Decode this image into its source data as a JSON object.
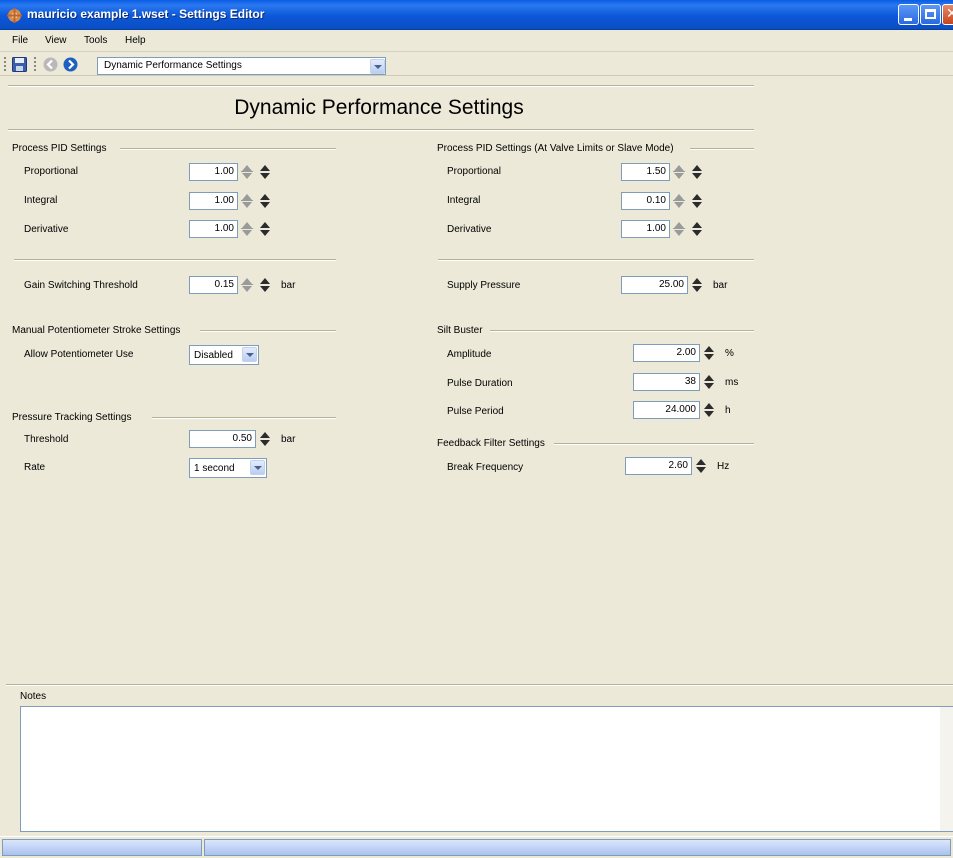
{
  "window": {
    "title": "mauricio example 1.wset - Settings Editor"
  },
  "menu": [
    "File",
    "View",
    "Tools",
    "Help"
  ],
  "toolbar": {
    "nav_combo_value": "Dynamic Performance Settings"
  },
  "page": {
    "heading": "Dynamic Performance Settings"
  },
  "left": {
    "process_pid": {
      "title": "Process PID Settings",
      "proportional_label": "Proportional",
      "proportional_value": "1.00",
      "integral_label": "Integral",
      "integral_value": "1.00",
      "derivative_label": "Derivative",
      "derivative_value": "1.00"
    },
    "gain_switching": {
      "label": "Gain Switching Threshold",
      "value": "0.15",
      "unit": "bar"
    },
    "manual_pot": {
      "title": "Manual Potentiometer Stroke Settings",
      "allow_label": "Allow Potentiometer Use",
      "allow_value": "Disabled"
    },
    "pressure_tracking": {
      "title": "Pressure Tracking Settings",
      "threshold_label": "Threshold",
      "threshold_value": "0.50",
      "threshold_unit": "bar",
      "rate_label": "Rate",
      "rate_value": "1 second"
    }
  },
  "right": {
    "process_pid_limits": {
      "title": "Process PID Settings (At Valve Limits or Slave Mode)",
      "proportional_label": "Proportional",
      "proportional_value": "1.50",
      "integral_label": "Integral",
      "integral_value": "0.10",
      "derivative_label": "Derivative",
      "derivative_value": "1.00"
    },
    "supply_pressure": {
      "label": "Supply Pressure",
      "value": "25.00",
      "unit": "bar"
    },
    "silt_buster": {
      "title": "Silt Buster",
      "amplitude_label": "Amplitude",
      "amplitude_value": "2.00",
      "amplitude_unit": "%",
      "pulse_duration_label": "Pulse Duration",
      "pulse_duration_value": "38",
      "pulse_duration_unit": "ms",
      "pulse_period_label": "Pulse Period",
      "pulse_period_value": "24.000",
      "pulse_period_unit": "h"
    },
    "feedback_filter": {
      "title": "Feedback Filter Settings",
      "break_frequency_label": "Break Frequency",
      "break_frequency_value": "2.60",
      "break_frequency_unit": "Hz"
    }
  },
  "notes": {
    "label": "Notes",
    "value": ""
  },
  "colors": {
    "titlebar": "#0a5de4",
    "window_bg": "#ece9d8",
    "field_border": "#7f9db9"
  }
}
